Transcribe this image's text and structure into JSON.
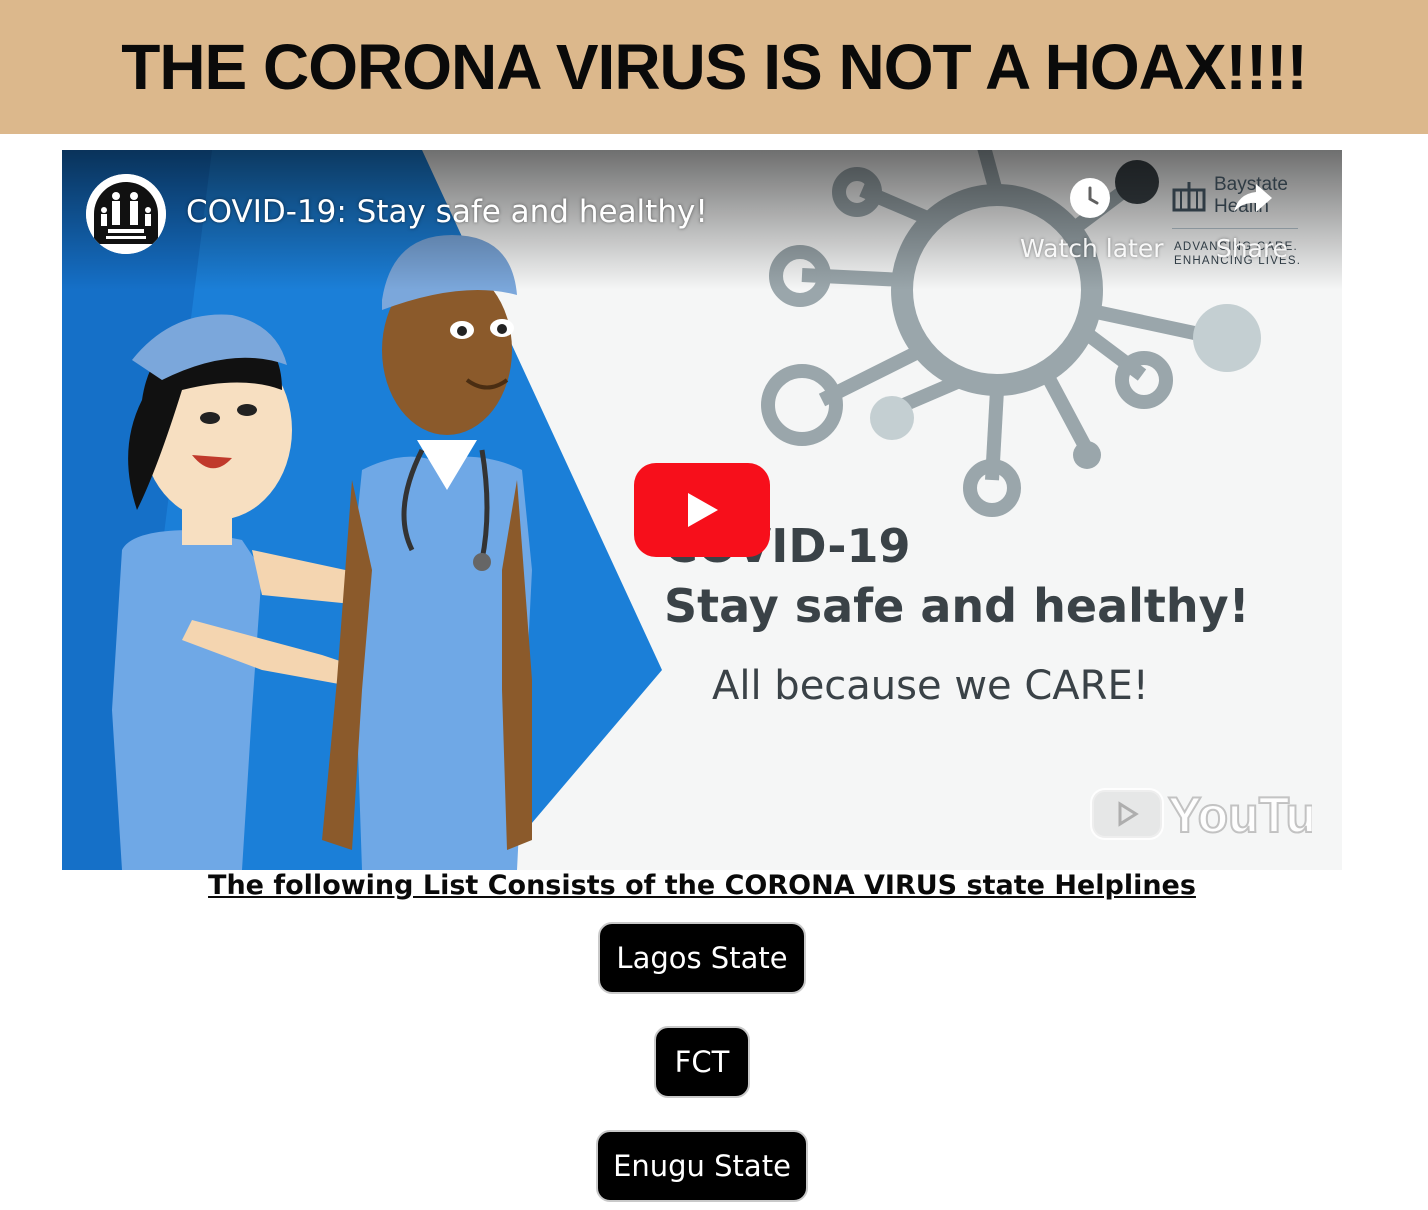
{
  "banner": {
    "title": "THE CORONA VIRUS IS NOT A HOAX!!!!",
    "background": "#dcb88c"
  },
  "video": {
    "title": "COVID-19: Stay safe and healthy!",
    "watch_later_label": "Watch later",
    "share_label": "Share",
    "brand": {
      "name_line1": "Baystate",
      "name_line2": "Health",
      "tagline_line1": "ADVANCING CARE.",
      "tagline_line2": "ENHANCING LIVES."
    },
    "slide": {
      "line1": "COVID-19",
      "line2": "Stay safe and healthy!",
      "line3": "All because we CARE!"
    },
    "watermark": "YouTube",
    "play_color": "#ff0000"
  },
  "helplines": {
    "heading": "The following List Consists of the CORONA VIRUS state Helplines",
    "states": [
      {
        "label": "Lagos State"
      },
      {
        "label": "FCT"
      },
      {
        "label": "Enugu State"
      }
    ]
  }
}
